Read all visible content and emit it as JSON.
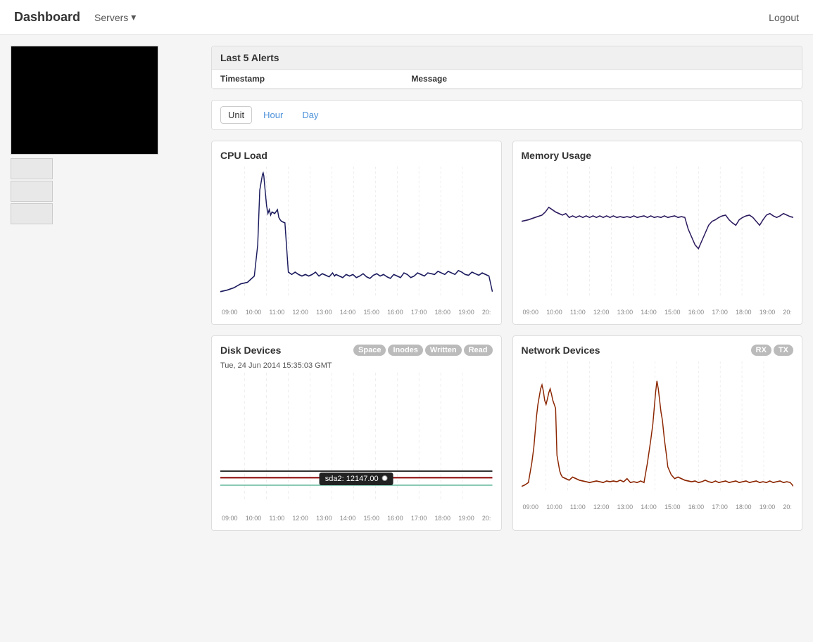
{
  "navbar": {
    "brand": "Dashboard",
    "servers_label": "Servers",
    "servers_dropdown_icon": "▾",
    "logout_label": "Logout"
  },
  "alerts": {
    "title": "Last 5 Alerts",
    "columns": {
      "timestamp": "Timestamp",
      "message": "Message"
    },
    "rows": []
  },
  "tabs": [
    {
      "label": "Unit",
      "active": true
    },
    {
      "label": "Hour",
      "active": false
    },
    {
      "label": "Day",
      "active": false
    }
  ],
  "cpu_chart": {
    "title": "CPU Load",
    "x_labels": [
      "09:00",
      "10:00",
      "11:00",
      "12:00",
      "13:00",
      "14:00",
      "15:00",
      "16:00",
      "17:00",
      "18:00",
      "19:00",
      "20:"
    ]
  },
  "memory_chart": {
    "title": "Memory Usage",
    "x_labels": [
      "09:00",
      "10:00",
      "11:00",
      "12:00",
      "13:00",
      "14:00",
      "15:00",
      "16:00",
      "17:00",
      "18:00",
      "19:00",
      "20:"
    ]
  },
  "disk_chart": {
    "title": "Disk Devices",
    "date_label": "Tue, 24 Jun 2014 15:35:03 GMT",
    "tooltip_label": "sda2: 12147.00",
    "badges": [
      "Space",
      "Inodes",
      "Written",
      "Read"
    ],
    "x_labels": [
      "09:00",
      "10:00",
      "11:00",
      "12:00",
      "13:00",
      "14:00",
      "15:00",
      "16:00",
      "17:00",
      "18:00",
      "19:00",
      "20:"
    ]
  },
  "network_chart": {
    "title": "Network Devices",
    "badges": [
      "RX",
      "TX"
    ],
    "x_labels": [
      "09:00",
      "10:00",
      "11:00",
      "12:00",
      "13:00",
      "14:00",
      "15:00",
      "16:00",
      "17:00",
      "18:00",
      "19:00",
      "20:"
    ]
  }
}
